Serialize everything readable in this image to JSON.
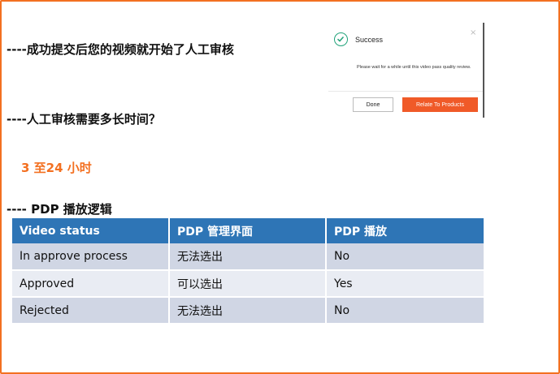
{
  "heading1": "----成功提交后您的视频就开始了人工审核",
  "heading2": "----人工审核需要多长时间？",
  "answer": "3 至24 小时",
  "heading3": "---- PDP 播放逻辑",
  "dialog": {
    "title": "Success",
    "message": "Please wait for a while until this video pass quality review.",
    "close": "×",
    "done_label": "Done",
    "relate_label": "Relate To Products",
    "accent": "#f05a28",
    "success_color": "#22a37a"
  },
  "table": {
    "headers": [
      "Video status",
      "PDP 管理界面",
      "PDP 播放"
    ],
    "rows": [
      [
        "In approve process",
        "无法选出",
        "No"
      ],
      [
        "Approved",
        "可以选出",
        "Yes"
      ],
      [
        "Rejected",
        "无法选出",
        "No"
      ]
    ],
    "header_color": "#2e75b6"
  },
  "frame_color": "#f37021"
}
